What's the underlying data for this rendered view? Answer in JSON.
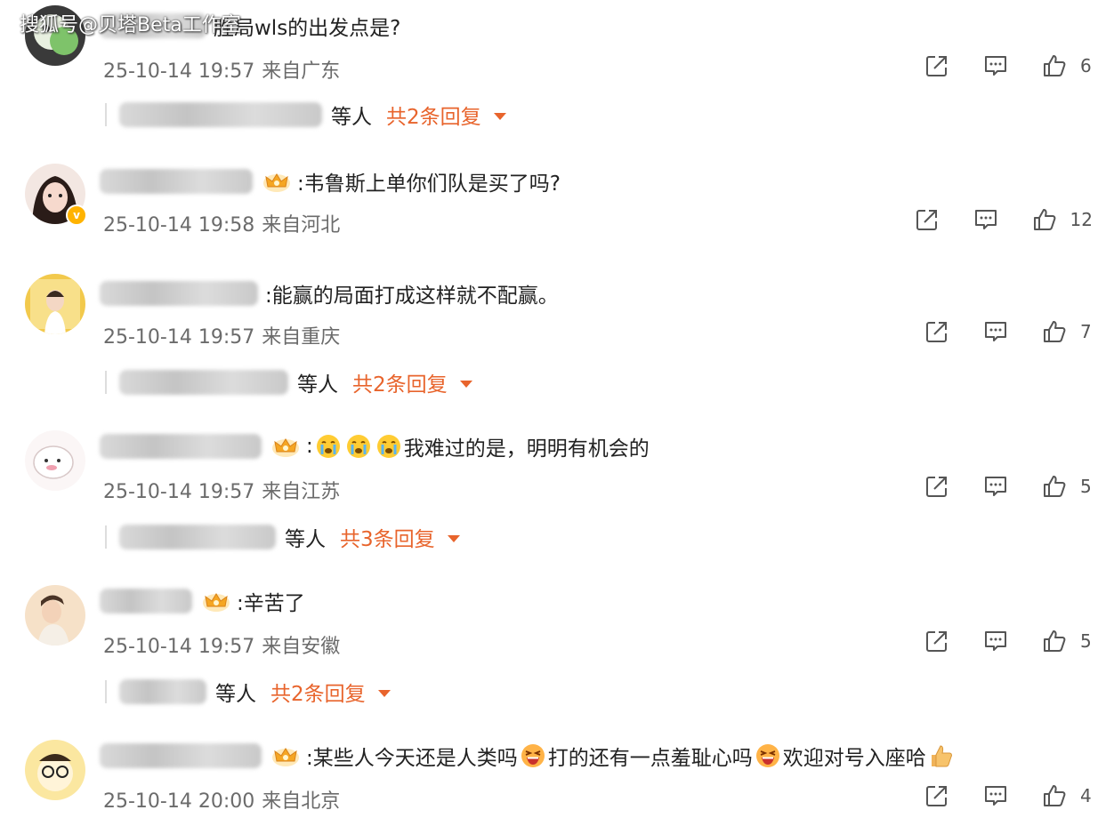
{
  "watermark": "搜狐号@贝塔Beta工作室",
  "ui": {
    "accent_color": "#e8642c",
    "meta_color": "#6b6b6b",
    "icons": [
      "share-icon",
      "comment-icon",
      "like-icon",
      "crown-badge-icon",
      "caret-down-icon"
    ]
  },
  "comments": [
    {
      "text": "胜局wls的出发点是?",
      "time": "25-10-14 19:57",
      "location": "来自广东",
      "likes": "6",
      "reply_who": "等人",
      "reply_count": "共2条回复"
    },
    {
      "text": ":韦鲁斯上单你们队是买了吗?",
      "time": "25-10-14 19:58",
      "location": "来自河北",
      "likes": "12"
    },
    {
      "text": ":能赢的局面打成这样就不配赢。",
      "time": "25-10-14 19:57",
      "location": "来自重庆",
      "likes": "7",
      "reply_who": "等人",
      "reply_count": "共2条回复"
    },
    {
      "text_prefix": ":",
      "text": "我难过的是，明明有机会的",
      "time": "25-10-14 19:57",
      "location": "来自江苏",
      "likes": "5",
      "reply_who": "等人",
      "reply_count": "共3条回复"
    },
    {
      "text": ":辛苦了",
      "time": "25-10-14 19:57",
      "location": "来自安徽",
      "likes": "5",
      "reply_who": "等人",
      "reply_count": "共2条回复"
    },
    {
      "text": ":某些人今天还是人类吗",
      "text_part2": "打的还有一点羞耻心吗",
      "text_part3": "欢迎对号入座哈",
      "time": "25-10-14 20:00",
      "location": "来自北京",
      "likes": "4"
    }
  ]
}
